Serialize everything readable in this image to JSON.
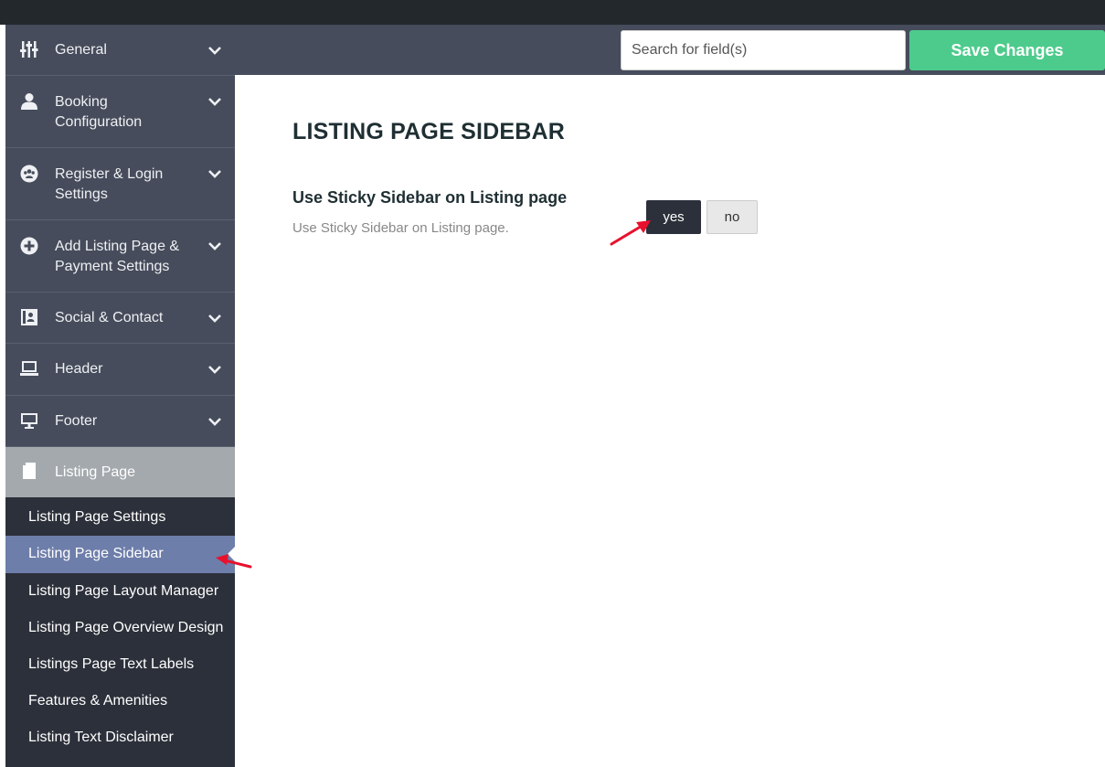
{
  "sidebar": {
    "items": [
      {
        "label": "General",
        "icon": "sliders-icon"
      },
      {
        "label": "Booking Configuration",
        "icon": "user-icon"
      },
      {
        "label": "Register & Login Settings",
        "icon": "users-circle-icon"
      },
      {
        "label": "Add Listing Page & Payment Settings",
        "icon": "plus-circle-icon"
      },
      {
        "label": "Social & Contact",
        "icon": "contact-card-icon"
      },
      {
        "label": "Header",
        "icon": "laptop-icon"
      },
      {
        "label": "Footer",
        "icon": "monitor-icon"
      },
      {
        "label": "Listing Page",
        "icon": "file-icon"
      }
    ],
    "submenu": [
      "Listing Page Settings",
      "Listing Page Sidebar",
      "Listing Page Layout Manager",
      "Listing Page Overview Design",
      "Listings Page Text Labels",
      "Features & Amenities",
      "Listing Text Disclaimer"
    ],
    "active_submenu": "Listing Page Sidebar"
  },
  "header": {
    "search_placeholder": "Search for field(s)",
    "save_label": "Save Changes"
  },
  "main": {
    "title": "LISTING PAGE SIDEBAR",
    "field": {
      "title": "Use Sticky Sidebar on Listing page",
      "description": "Use Sticky Sidebar on Listing page.",
      "options": [
        "yes",
        "no"
      ],
      "selected": "yes"
    }
  },
  "colors": {
    "sidebar_bg": "#2c303a",
    "menu_bg": "#464c5b",
    "active_bg": "#a4a9ad",
    "submenu_highlight": "#6e7eaa",
    "save_green": "#4dcb8c",
    "annotation_red": "#e8112d"
  }
}
